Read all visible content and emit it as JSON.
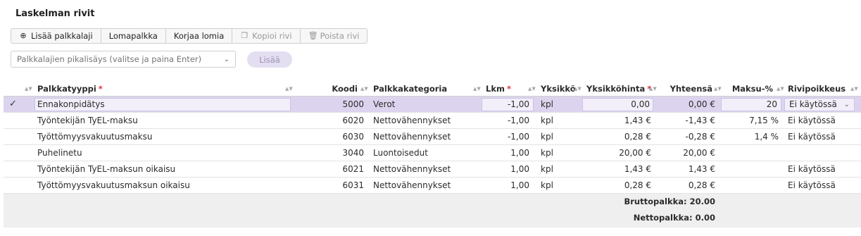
{
  "title": "Laskelman rivit",
  "toolbar": [
    {
      "label": "Lisää palkkalaji",
      "icon": "⊕",
      "icon_name": "plus-circle-icon",
      "enabled": true
    },
    {
      "label": "Lomapalkka",
      "enabled": true
    },
    {
      "label": "Korjaa lomia",
      "enabled": true
    },
    {
      "label": "Kopioi rivi",
      "icon": "❐",
      "icon_name": "copy-icon",
      "enabled": false
    },
    {
      "label": "Poista rivi",
      "icon": "🗑",
      "icon_name": "trash-icon",
      "enabled": false
    }
  ],
  "quick_add": {
    "placeholder": "Palkkalajien pikalisäys (valitse ja paina Enter)",
    "button": "Lisää"
  },
  "columns": {
    "palkkatyyppi": "Palkkatyyppi",
    "koodi": "Koodi",
    "palkkakategoria": "Palkkakategoria",
    "lkm": "Lkm",
    "yksikko": "Yksikkö",
    "yksikkohinta": "Yksikköhinta",
    "yhteensa": "Yhteensä",
    "maksu": "Maksu-%",
    "rivipoikkeus": "Rivipoikkeus",
    "required_mark": "*"
  },
  "rows": [
    {
      "palkkatyyppi": "Ennakonpidätys",
      "koodi": "5000",
      "palkkakategoria": "Verot",
      "lkm": "-1,00",
      "yksikko": "kpl",
      "yksikkohinta": "0,00",
      "yhteensa": "0,00 €",
      "maksu": "20",
      "rivipoikkeus": "Ei käytössä",
      "selected": true
    },
    {
      "palkkatyyppi": "Työntekijän TyEL-maksu",
      "koodi": "6020",
      "palkkakategoria": "Nettovähennykset",
      "lkm": "-1,00",
      "yksikko": "kpl",
      "yksikkohinta": "1,43 €",
      "yhteensa": "-1,43 €",
      "maksu": "7,15 %",
      "rivipoikkeus": "Ei käytössä"
    },
    {
      "palkkatyyppi": "Työttömyysvakuutusmaksu",
      "koodi": "6030",
      "palkkakategoria": "Nettovähennykset",
      "lkm": "-1,00",
      "yksikko": "kpl",
      "yksikkohinta": "0,28 €",
      "yhteensa": "-0,28 €",
      "maksu": "1,4 %",
      "rivipoikkeus": "Ei käytössä"
    },
    {
      "palkkatyyppi": "Puhelinetu",
      "koodi": "3040",
      "palkkakategoria": "Luontoisedut",
      "lkm": "1,00",
      "yksikko": "kpl",
      "yksikkohinta": "20,00 €",
      "yhteensa": "20,00 €",
      "maksu": "",
      "rivipoikkeus": ""
    },
    {
      "palkkatyyppi": "Työntekijän TyEL-maksun oikaisu",
      "koodi": "6021",
      "palkkakategoria": "Nettovähennykset",
      "lkm": "1,00",
      "yksikko": "kpl",
      "yksikkohinta": "1,43 €",
      "yhteensa": "1,43 €",
      "maksu": "",
      "rivipoikkeus": "Ei käytössä"
    },
    {
      "palkkatyyppi": "Työttömyysvakuutusmaksun oikaisu",
      "koodi": "6031",
      "palkkakategoria": "Nettovähennykset",
      "lkm": "1,00",
      "yksikko": "kpl",
      "yksikkohinta": "0,28 €",
      "yhteensa": "0,28 €",
      "maksu": "",
      "rivipoikkeus": "Ei käytössä"
    }
  ],
  "totals": {
    "brutto": "Bruttopalkka: 20.00",
    "netto": "Nettopalkka: 0.00"
  },
  "colors": {
    "selected_row": "#dcd4ee",
    "required": "#d9363e",
    "footer": "#efefef"
  }
}
